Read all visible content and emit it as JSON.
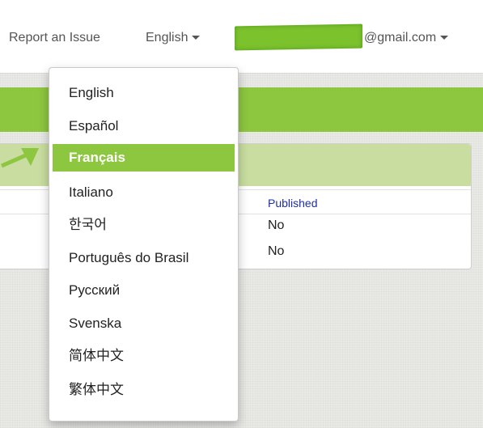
{
  "header": {
    "report_issue": "Report an Issue",
    "language": "English",
    "account_email_suffix": "@gmail.com"
  },
  "table": {
    "column_published": "Published",
    "rows": [
      {
        "published": "No"
      },
      {
        "published": "No"
      }
    ]
  },
  "language_menu": {
    "items": [
      "English",
      "Español",
      "Français",
      "Italiano",
      "한국어",
      "Português do Brasil",
      "Русский",
      "Svenska",
      "简体中文",
      "繁体中文"
    ],
    "highlighted": "Français"
  },
  "colors": {
    "accent_green": "#8dc63f",
    "panel_header": "#c8dd9f",
    "arrow": "#8dc63f"
  }
}
